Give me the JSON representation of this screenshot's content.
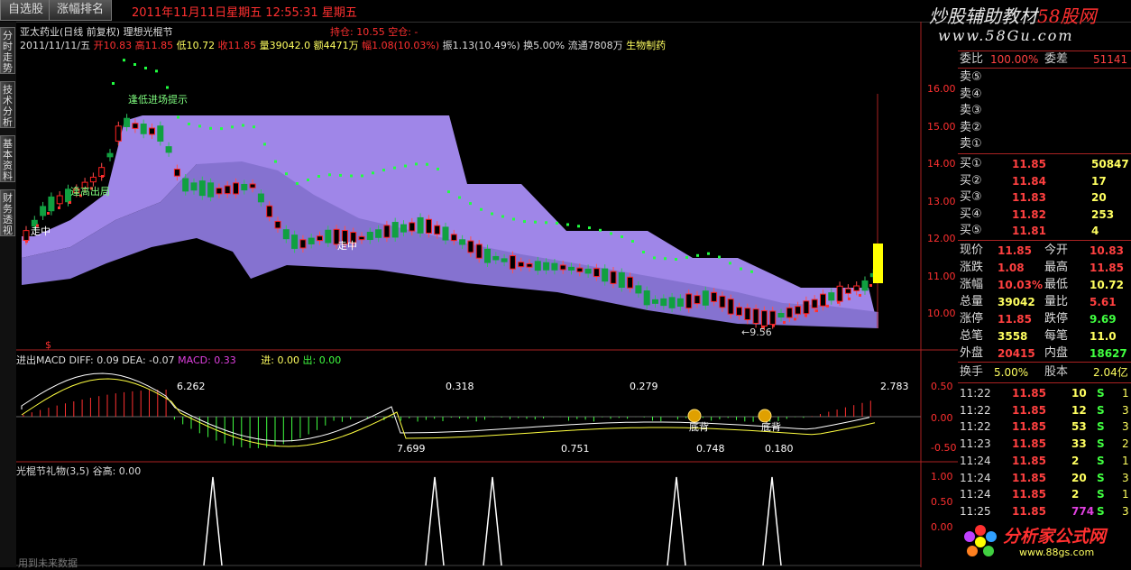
{
  "topbar": {
    "tab1": "自选股",
    "tab2": "涨幅排名",
    "clock": "2011年11月11日星期五  12:55:31 星期五",
    "brand_main": "炒股辅助教材",
    "brand_red": "58股网",
    "brand_url": "www.58Gu.com"
  },
  "sidetabs": [
    "分时走势",
    "技术分析",
    "基本资料",
    "财务透视"
  ],
  "chart_header": {
    "line1": "亚太药业(日线 前复权) 理想光棍节",
    "line1_right": "持仓: 10.55  空仓: -",
    "date": "2011/11/11/五",
    "open": "开10.83",
    "high": "高11.85",
    "low": "低10.72",
    "close": "收11.85",
    "volume": "量39042.0",
    "amount": "额4471万",
    "change": "幅1.08(10.03%)",
    "amplitude": "振1.13(10.49%)",
    "turnover": "换5.00%",
    "float": "流通7808万",
    "sector": "生物制药"
  },
  "chart_annotations": {
    "entry_hint": "逢低进场提示",
    "exit_hint": "逢高出局",
    "walk1": "走中",
    "walk2": "走中",
    "low_mark": "←9.56",
    "dollar": "$"
  },
  "price_axis": [
    "16.00",
    "15.00",
    "14.00",
    "13.00",
    "12.00",
    "11.00",
    "10.00"
  ],
  "macd": {
    "title": "进出MACD",
    "diff": "DIFF: 0.09",
    "dea": "DEA: -0.07",
    "macd": "MACD: 0.33",
    "jin": "进: 0.00",
    "chu": "出: 0.00",
    "labels": [
      "6.262",
      "0.318",
      "0.279",
      "2.783",
      "7.699",
      "0.751",
      "0.748",
      "0.180"
    ],
    "dibei1": "底背",
    "dibei2": "底背",
    "axis": [
      "0.50",
      "0.00",
      "-0.50"
    ]
  },
  "gift": {
    "title": "光棍节礼物(3,5)",
    "value": "谷高: 0.00",
    "axis": [
      "1.00",
      "0.50",
      "0.00"
    ],
    "bottom_text": "用到未来数据"
  },
  "quote": {
    "ratio_label": "委比",
    "ratio_val": "100.00%",
    "diff_label": "委差",
    "diff_val": "51141",
    "sell": [
      {
        "label": "卖⑤",
        "price": "",
        "vol": ""
      },
      {
        "label": "卖④",
        "price": "",
        "vol": ""
      },
      {
        "label": "卖③",
        "price": "",
        "vol": ""
      },
      {
        "label": "卖②",
        "price": "",
        "vol": ""
      },
      {
        "label": "卖①",
        "price": "",
        "vol": ""
      }
    ],
    "buy": [
      {
        "label": "买①",
        "price": "11.85",
        "vol": "50847"
      },
      {
        "label": "买②",
        "price": "11.84",
        "vol": "17"
      },
      {
        "label": "买③",
        "price": "11.83",
        "vol": "20"
      },
      {
        "label": "买④",
        "price": "11.82",
        "vol": "253"
      },
      {
        "label": "买⑤",
        "price": "11.81",
        "vol": "4"
      }
    ],
    "stats": [
      {
        "l1": "现价",
        "v1": "11.85",
        "l2": "今开",
        "v2": "10.83"
      },
      {
        "l1": "涨跌",
        "v1": "1.08",
        "l2": "最高",
        "v2": "11.85"
      },
      {
        "l1": "涨幅",
        "v1": "10.03%",
        "l2": "最低",
        "v2": "10.72"
      },
      {
        "l1": "总量",
        "v1": "39042",
        "l2": "量比",
        "v2": "5.61"
      },
      {
        "l1": "涨停",
        "v1": "11.85",
        "l2": "跌停",
        "v2": "9.69"
      },
      {
        "l1": "总笔",
        "v1": "3558",
        "l2": "每笔",
        "v2": "11.0"
      },
      {
        "l1": "外盘",
        "v1": "20415",
        "l2": "内盘",
        "v2": "18627"
      }
    ],
    "turn_label": "换手",
    "turn_val": "5.00%",
    "cap_label": "股本",
    "cap_val": "2.04亿",
    "ticks": [
      {
        "time": "11:22",
        "price": "11.85",
        "vol": "10",
        "side": "S",
        "n": "1"
      },
      {
        "time": "11:22",
        "price": "11.85",
        "vol": "12",
        "side": "S",
        "n": "3"
      },
      {
        "time": "11:22",
        "price": "11.85",
        "vol": "53",
        "side": "S",
        "n": "3"
      },
      {
        "time": "11:23",
        "price": "11.85",
        "vol": "33",
        "side": "S",
        "n": "2"
      },
      {
        "time": "11:24",
        "price": "11.85",
        "vol": "2",
        "side": "S",
        "n": "1"
      },
      {
        "time": "11:24",
        "price": "11.85",
        "vol": "20",
        "side": "S",
        "n": "3"
      },
      {
        "time": "11:24",
        "price": "11.85",
        "vol": "2",
        "side": "S",
        "n": "1"
      },
      {
        "time": "11:25",
        "price": "11.85",
        "vol": "774",
        "side": "S",
        "n": "3"
      }
    ],
    "logo_text": "分析家公式网",
    "logo_url": "www.88gs.com"
  }
}
